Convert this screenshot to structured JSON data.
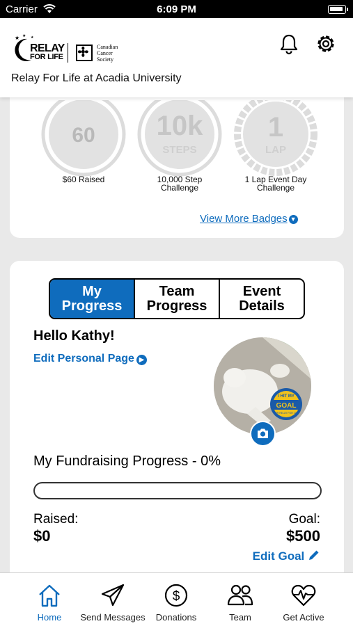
{
  "status_bar": {
    "carrier": "Carrier",
    "time": "6:09 PM"
  },
  "header": {
    "logo": {
      "line1": "RELAY",
      "line2": "FOR LIFE",
      "partner_line1": "Canadian",
      "partner_line2": "Cancer",
      "partner_line3": "Society"
    },
    "event_title": "Relay For Life at Acadia University",
    "icons": [
      "bell-icon",
      "gear-icon"
    ]
  },
  "badges": {
    "items": [
      {
        "value": "60",
        "sub": "",
        "caption_line1": "$60 Raised",
        "caption_line2": ""
      },
      {
        "value": "10k",
        "sub": "STEPS",
        "caption_line1": "10,000 Step",
        "caption_line2": "Challenge"
      },
      {
        "value": "1",
        "sub": "LAP",
        "caption_line1": "1 Lap Event Day",
        "caption_line2": "Challenge"
      }
    ],
    "view_more": "View More Badges"
  },
  "progress": {
    "tabs": [
      {
        "line1": "My",
        "line2": "Progress"
      },
      {
        "line1": "Team",
        "line2": "Progress"
      },
      {
        "line1": "Event",
        "line2": "Details"
      }
    ],
    "greeting": "Hello Kathy!",
    "edit_page": "Edit Personal Page",
    "photo_badge_line1": "I HIT MY",
    "photo_badge_line2": "GOAL",
    "photo_badge_line3": "FOR RELAY FOR LIFE",
    "fundraising_title": "My Fundraising Progress - 0%",
    "progress_fraction": 0,
    "raised_label": "Raised:",
    "raised_value": "$0",
    "goal_label": "Goal:",
    "goal_value": "$500",
    "edit_goal": "Edit Goal"
  },
  "tabbar": {
    "items": [
      {
        "label": "Home",
        "icon": "home-icon",
        "active": true
      },
      {
        "label": "Send Messages",
        "icon": "paper-plane-icon",
        "active": false
      },
      {
        "label": "Donations",
        "icon": "dollar-icon",
        "active": false
      },
      {
        "label": "Team",
        "icon": "team-icon",
        "active": false
      },
      {
        "label": "Get Active",
        "icon": "heart-pulse-icon",
        "active": false
      }
    ]
  },
  "colors": {
    "accent": "#0f6cbd",
    "badge_gray": "#d9d9d9",
    "background": "#e9e9e9"
  }
}
